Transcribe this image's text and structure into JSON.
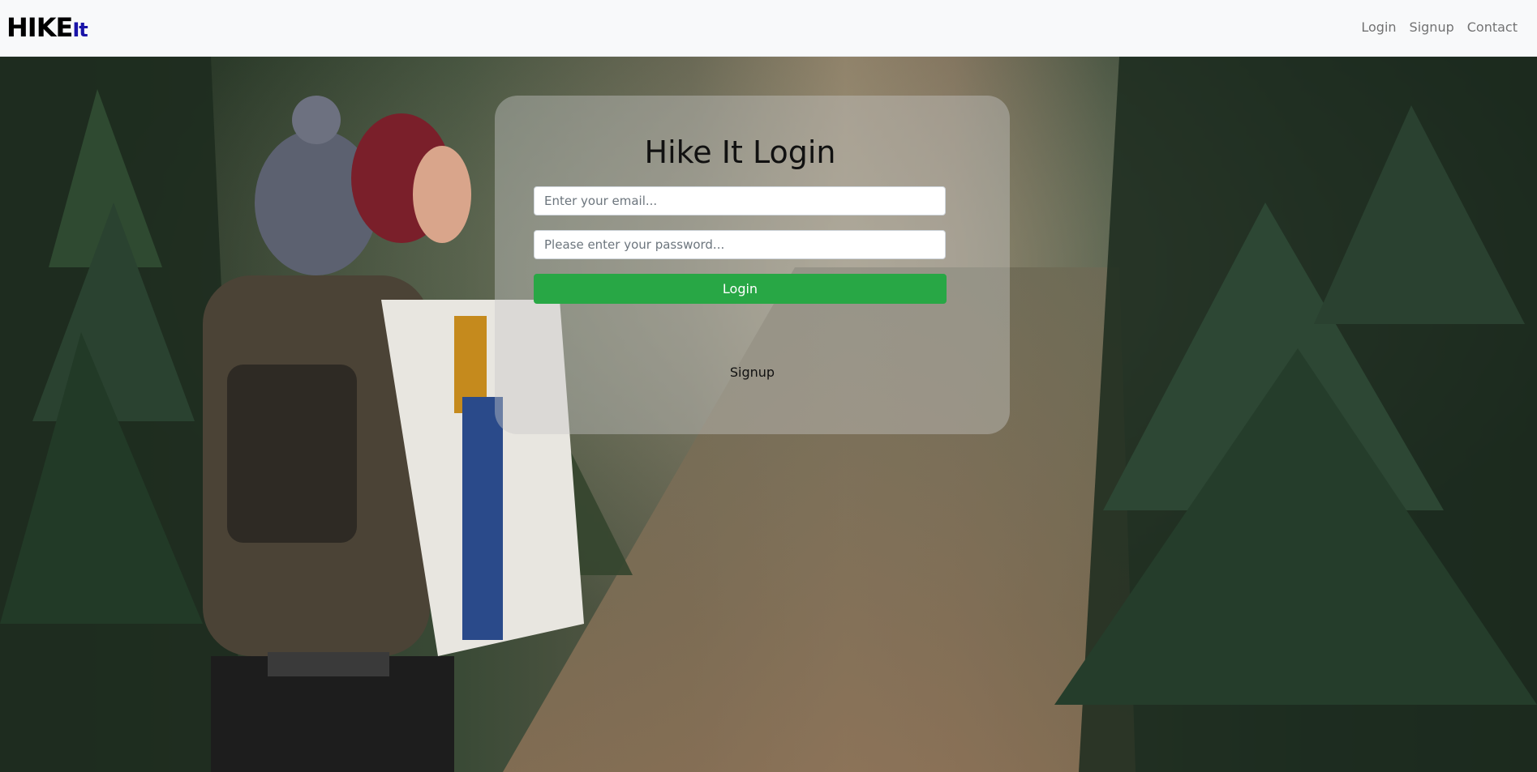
{
  "navbar": {
    "brand_main": "HIKE",
    "brand_accent": "It",
    "links": [
      "Login",
      "Signup",
      "Contact"
    ]
  },
  "hero": {
    "image": "forest-trail-hikers-photo"
  },
  "login_card": {
    "title": "Hike It Login",
    "email_placeholder": "Enter your email...",
    "password_placeholder": "Please enter your password...",
    "login_label": "Login",
    "signup_label": "Signup"
  },
  "colors": {
    "navbar_bg": "#f8f9fa",
    "brand_accent": "#1a14a8",
    "login_button": "#28a745"
  }
}
